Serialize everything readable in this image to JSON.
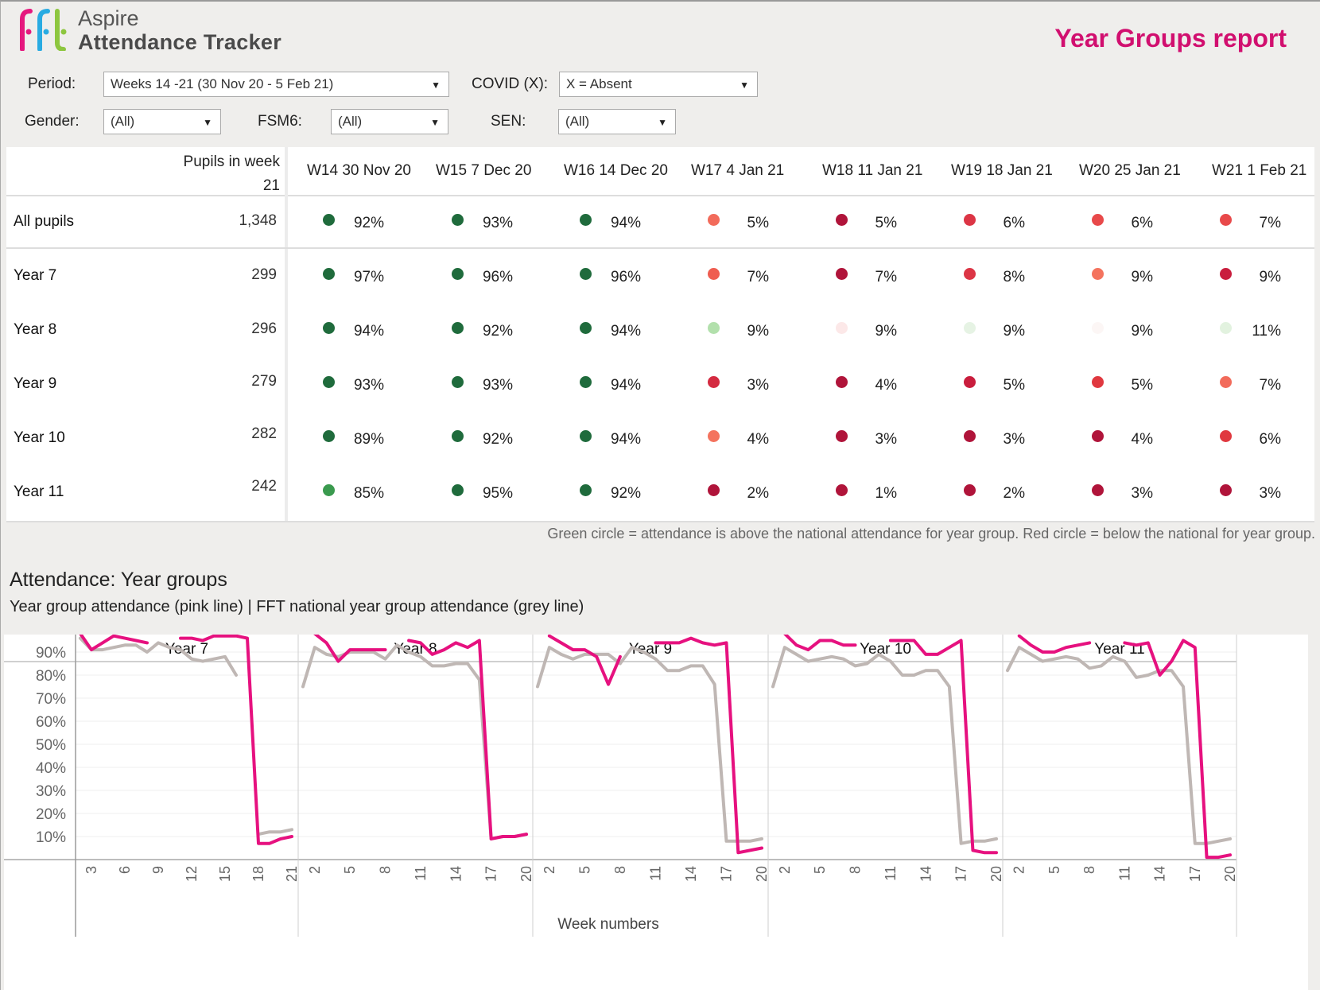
{
  "header": {
    "brand_line1": "Aspire",
    "brand_line2": "Attendance Tracker",
    "report_title": "Year Groups report",
    "logo_colors": [
      "#e5177e",
      "#29abe2",
      "#8dc63f"
    ]
  },
  "filters": {
    "period": {
      "label": "Period:",
      "value": "Weeks 14 -21 (30 Nov 20 - 5 Feb 21)"
    },
    "covid": {
      "label": "COVID (X):",
      "value": "X = Absent"
    },
    "gender": {
      "label": "Gender:",
      "value": "(All)"
    },
    "fsm6": {
      "label": "FSM6:",
      "value": "(All)"
    },
    "sen": {
      "label": "SEN:",
      "value": "(All)"
    },
    "dropdown_arrow": "▼"
  },
  "table": {
    "pupils_header_line1": "Pupils in week",
    "pupils_header_line2": "21",
    "weeks": [
      "W14 30 Nov 20",
      "W15 7 Dec 20",
      "W16 14 Dec 20",
      "W17 4 Jan 21",
      "W18 11 Jan 21",
      "W19 18 Jan 21",
      "W20 25 Jan 21",
      "W21 1 Feb 21"
    ],
    "rows": [
      {
        "label": "All pupils",
        "count": "1,348",
        "values": [
          "92%",
          "93%",
          "94%",
          "5%",
          "5%",
          "6%",
          "6%",
          "7%"
        ],
        "colors": [
          "#1f6b3c",
          "#1f6b3c",
          "#1f6b3c",
          "#f26b5b",
          "#b0143a",
          "#dc3545",
          "#e8494a",
          "#e8494a"
        ]
      },
      {
        "label": "Year 7",
        "count": "299",
        "values": [
          "97%",
          "96%",
          "96%",
          "7%",
          "7%",
          "8%",
          "9%",
          "9%"
        ],
        "colors": [
          "#1f6b3c",
          "#1f6b3c",
          "#1f6b3c",
          "#ef5d50",
          "#b0143a",
          "#dc3545",
          "#f4735e",
          "#c91d3d"
        ]
      },
      {
        "label": "Year 8",
        "count": "296",
        "values": [
          "94%",
          "92%",
          "94%",
          "9%",
          "9%",
          "9%",
          "9%",
          "11%"
        ],
        "colors": [
          "#1f6b3c",
          "#1f6b3c",
          "#1f6b3c",
          "#b2e0ac",
          "#fce8e8",
          "#e6f3e4",
          "#fcf6f5",
          "#e2f2df"
        ]
      },
      {
        "label": "Year 9",
        "count": "279",
        "values": [
          "93%",
          "93%",
          "94%",
          "3%",
          "4%",
          "5%",
          "5%",
          "7%"
        ],
        "colors": [
          "#1f6b3c",
          "#1f6b3c",
          "#1f6b3c",
          "#d42a40",
          "#b0143a",
          "#c91d3d",
          "#e0383f",
          "#f26b5b"
        ]
      },
      {
        "label": "Year 10",
        "count": "282",
        "values": [
          "89%",
          "92%",
          "94%",
          "4%",
          "3%",
          "3%",
          "4%",
          "6%"
        ],
        "colors": [
          "#1f6b3c",
          "#1f6b3c",
          "#1f6b3c",
          "#f4735e",
          "#b0143a",
          "#b0143a",
          "#b0143a",
          "#e0383f"
        ]
      },
      {
        "label": "Year 11",
        "count": "242",
        "values": [
          "85%",
          "95%",
          "92%",
          "2%",
          "1%",
          "2%",
          "3%",
          "3%"
        ],
        "colors": [
          "#3a9a4e",
          "#1f6b3c",
          "#1f6b3c",
          "#b0143a",
          "#b0143a",
          "#b0143a",
          "#b0143a",
          "#b0143a"
        ]
      }
    ],
    "footnote": "Green circle = attendance is above the national attendance for year group. Red circle =  below the national for year group."
  },
  "section": {
    "title": "Attendance: Year groups",
    "subtitle": "Year group attendance (pink line) |  FFT national year group attendance (grey line)"
  },
  "chart_data": {
    "type": "line",
    "title": "Attendance: Year groups",
    "subtitle": "Year group attendance (pink line) |  FFT national year group attendance (grey line)",
    "xlabel": "Week numbers",
    "ylabel": "",
    "ylim": [
      0,
      100
    ],
    "y_ticks": [
      "10%",
      "20%",
      "30%",
      "40%",
      "50%",
      "60%",
      "70%",
      "80%",
      "90%"
    ],
    "y_tick_values": [
      10,
      20,
      30,
      40,
      50,
      60,
      70,
      80,
      90
    ],
    "grid": true,
    "series_colors": {
      "school": "#e6117f",
      "national": "#bfb7b4"
    },
    "panels": [
      {
        "name": "Year 7",
        "x": [
          2,
          3,
          4,
          5,
          6,
          7,
          8,
          9,
          10,
          11,
          12,
          13,
          14,
          15,
          16,
          17,
          18,
          19,
          20,
          21
        ],
        "x_ticks": [
          3,
          6,
          9,
          12,
          15,
          18,
          21
        ],
        "school": [
          98,
          91,
          94,
          97,
          96,
          95,
          94,
          null,
          null,
          96,
          96,
          95,
          97,
          97,
          97,
          96,
          7,
          7,
          9,
          10
        ],
        "national": [
          96,
          91,
          91,
          92,
          93,
          93,
          90,
          94,
          92,
          91,
          87,
          86,
          87,
          88,
          80,
          null,
          11,
          12,
          12,
          13
        ]
      },
      {
        "name": "Year 8",
        "x": [
          1,
          2,
          3,
          4,
          5,
          6,
          7,
          8,
          9,
          10,
          11,
          12,
          13,
          14,
          15,
          16,
          17,
          18,
          19,
          20
        ],
        "x_ticks": [
          2,
          5,
          8,
          11,
          14,
          17,
          20
        ],
        "school": [
          null,
          98,
          94,
          86,
          91,
          91,
          91,
          91,
          null,
          95,
          94,
          89,
          91,
          94,
          92,
          95,
          9,
          10,
          10,
          11
        ],
        "national": [
          75,
          92,
          89,
          88,
          90,
          90,
          90,
          87,
          93,
          90,
          88,
          84,
          84,
          85,
          85,
          78,
          9,
          10,
          10,
          11
        ]
      },
      {
        "name": "Year 9",
        "x": [
          1,
          2,
          3,
          4,
          5,
          6,
          7,
          8,
          9,
          10,
          11,
          12,
          13,
          14,
          15,
          16,
          17,
          18,
          19,
          20
        ],
        "x_ticks": [
          2,
          5,
          8,
          11,
          14,
          17,
          20
        ],
        "school": [
          null,
          97,
          94,
          91,
          91,
          88,
          76,
          88,
          null,
          null,
          94,
          94,
          94,
          96,
          94,
          93,
          94,
          3,
          4,
          5,
          7
        ],
        "national": [
          75,
          92,
          89,
          87,
          89,
          89,
          89,
          85,
          92,
          90,
          87,
          82,
          82,
          84,
          84,
          76,
          8,
          8,
          8,
          9
        ]
      },
      {
        "name": "Year 10",
        "x": [
          1,
          2,
          3,
          4,
          5,
          6,
          7,
          8,
          9,
          10,
          11,
          12,
          13,
          14,
          15,
          16,
          17,
          18,
          19,
          20
        ],
        "x_ticks": [
          2,
          5,
          8,
          11,
          14,
          17,
          20
        ],
        "school": [
          null,
          98,
          93,
          91,
          95,
          95,
          93,
          93,
          null,
          null,
          95,
          95,
          95,
          89,
          89,
          92,
          95,
          4,
          3,
          3,
          6
        ],
        "national": [
          75,
          92,
          89,
          86,
          87,
          88,
          87,
          84,
          85,
          89,
          86,
          80,
          80,
          82,
          82,
          75,
          7,
          8,
          8,
          9
        ]
      },
      {
        "name": "Year 11",
        "x": [
          1,
          2,
          3,
          4,
          5,
          6,
          7,
          8,
          9,
          10,
          11,
          12,
          13,
          14,
          15,
          16,
          17,
          18,
          19,
          20
        ],
        "x_ticks": [
          2,
          5,
          8,
          11,
          14,
          17,
          20
        ],
        "school": [
          null,
          97,
          93,
          90,
          90,
          92,
          93,
          94,
          null,
          null,
          94,
          93,
          94,
          80,
          86,
          95,
          92,
          1,
          1,
          2,
          3
        ],
        "national": [
          82,
          92,
          89,
          86,
          87,
          88,
          87,
          83,
          84,
          88,
          86,
          79,
          80,
          82,
          82,
          75,
          7,
          7,
          8,
          9
        ]
      }
    ]
  }
}
